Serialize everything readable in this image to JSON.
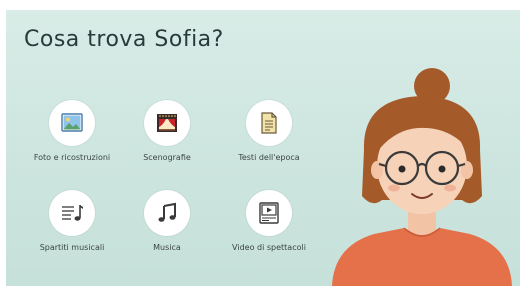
{
  "title": "Cosa trova Sofia?",
  "items": [
    {
      "label": "Foto e ricostruzioni",
      "icon": "image-icon"
    },
    {
      "label": "Scenografie",
      "icon": "theater-stage-icon"
    },
    {
      "label": "Testi dell'epoca",
      "icon": "document-icon"
    },
    {
      "label": "Spartiti musicali",
      "icon": "sheet-music-icon"
    },
    {
      "label": "Musica",
      "icon": "music-note-icon"
    },
    {
      "label": "Video di spettacoli",
      "icon": "video-icon"
    }
  ],
  "colors": {
    "background": "#cfe6e0",
    "icon_circle": "#ffffff",
    "hair": "#a55a2a",
    "skin": "#f6d3b8",
    "shirt": "#e5714a"
  }
}
